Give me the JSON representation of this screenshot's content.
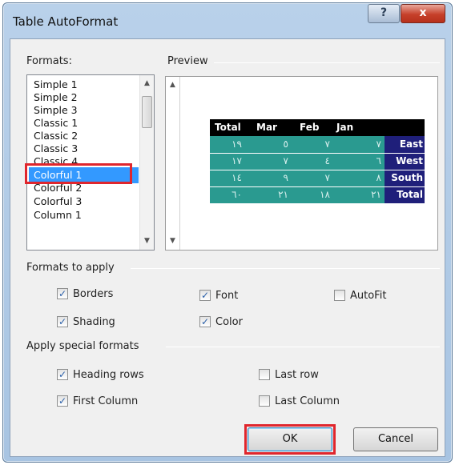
{
  "window": {
    "title": "Table AutoFormat",
    "help_label": "?",
    "close_label": "x"
  },
  "formats": {
    "label": "Formats:",
    "items": [
      "Simple 1",
      "Simple 2",
      "Simple 3",
      "Classic 1",
      "Classic 2",
      "Classic 3",
      "Classic 4",
      "Colorful 1",
      "Colorful 2",
      "Colorful 3",
      "Column 1"
    ],
    "selected": "Colorful 1"
  },
  "preview": {
    "label": "Preview",
    "columns": [
      "Total",
      "Mar",
      "Feb",
      "Jan",
      ""
    ],
    "rows": [
      [
        "١٩",
        "٥",
        "٧",
        "٧",
        "East"
      ],
      [
        "١٧",
        "٧",
        "٤",
        "٦",
        "West"
      ],
      [
        "١٤",
        "٩",
        "٧",
        "٨",
        "South"
      ],
      [
        "٦٠",
        "٢١",
        "١٨",
        "٢١",
        "Total"
      ]
    ]
  },
  "formats_to_apply": {
    "label": "Formats to apply",
    "options": [
      {
        "label": "Borders",
        "checked": true
      },
      {
        "label": "Font",
        "checked": true
      },
      {
        "label": "AutoFit",
        "checked": false
      },
      {
        "label": "Shading",
        "checked": true
      },
      {
        "label": "Color",
        "checked": true
      }
    ]
  },
  "special_formats": {
    "label": "Apply special formats",
    "options": [
      {
        "label": "Heading rows",
        "checked": true
      },
      {
        "label": "Last row",
        "checked": false
      },
      {
        "label": "First Column",
        "checked": true
      },
      {
        "label": "Last Column",
        "checked": false
      }
    ]
  },
  "buttons": {
    "ok": "OK",
    "cancel": "Cancel"
  },
  "colors": {
    "header_bg": "#000000",
    "body_bg": "#2a9a90",
    "label_col_bg": "#1f1f7a",
    "highlight": "#e0262d",
    "selection": "#3399ff"
  }
}
